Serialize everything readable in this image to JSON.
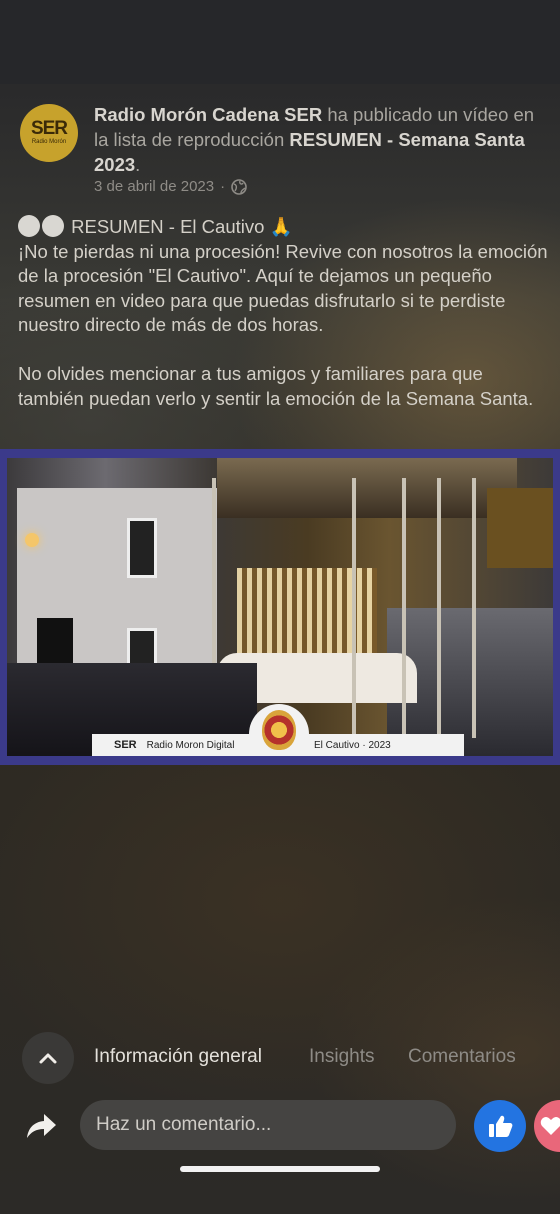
{
  "post": {
    "page_name": "Radio Morón Cadena SER",
    "action_text": " ha publicado un vídeo en la lista de reproducción ",
    "playlist": "RESUMEN - Semana Santa 2023",
    "playlist_suffix": ".",
    "date": "3 de abril de 2023",
    "separator": "·",
    "avatar_logo_text": "SER",
    "avatar_logo_sub": "Radio Morón",
    "title_line": "RESUMEN - El Cautivo 🙏",
    "body_paragraph_1": "¡No te pierdas ni una procesión! Revive con nosotros la emoción de la procesión \"El Cautivo\". Aquí te dejamos un pequeño resumen en video para que puedas disfrutarlo si te perdiste nuestro directo de más de dos horas.",
    "body_paragraph_2": "No olvides mencionar a tus amigos y familiares para que también puedan verlo y sentir la emoción de la Semana Santa."
  },
  "video": {
    "banner_logo": "SER",
    "banner_left": "Radio Moron Digital",
    "banner_right": "El Cautivo · 2023",
    "frame_color": "#3b3a8a"
  },
  "tabs": {
    "items": [
      {
        "label": "Información general",
        "active": true
      },
      {
        "label": "Insights",
        "active": false
      },
      {
        "label": "Comentarios",
        "active": false
      }
    ]
  },
  "comment": {
    "placeholder": "Haz un comentario..."
  },
  "colors": {
    "like_blue": "#2374e1",
    "love_pink": "#e9677a",
    "avatar_gold": "#c7a22c"
  }
}
